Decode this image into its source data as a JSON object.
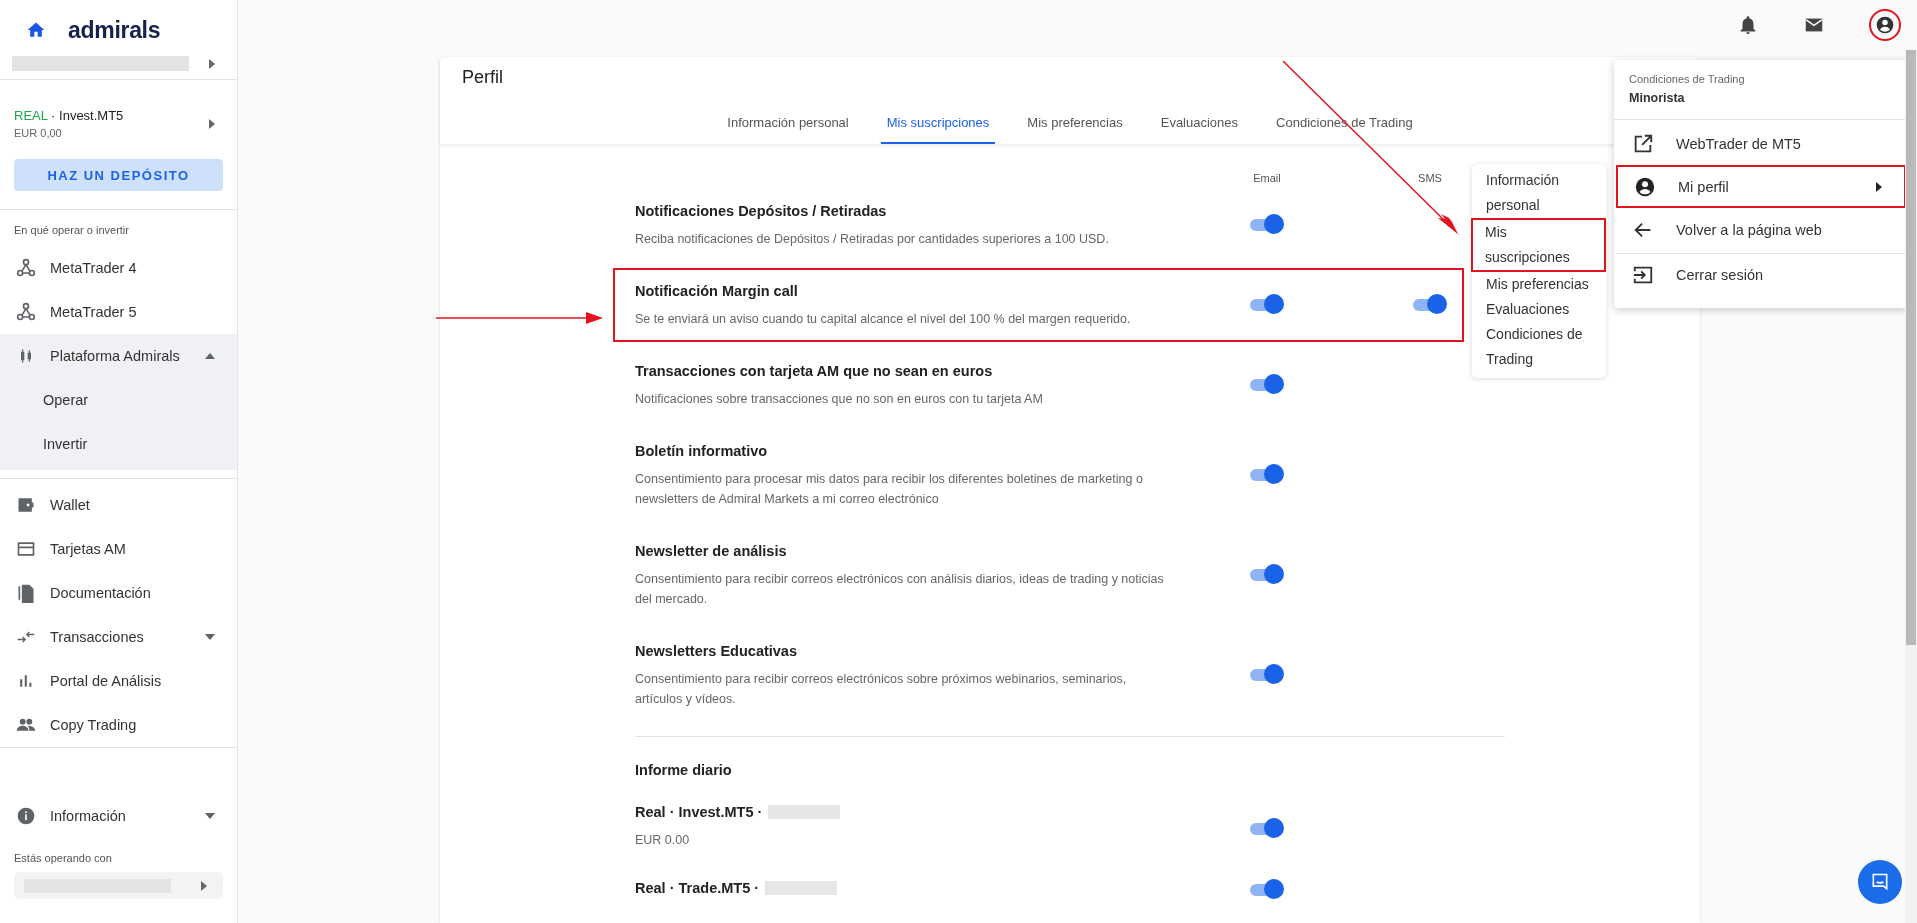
{
  "sidebar": {
    "brand": "admirals",
    "account": {
      "type": "REAL",
      "name": "· Invest.MT5",
      "balance": "EUR 0,00"
    },
    "deposit_button": "HAZ UN DEPÓSITO",
    "sections": [
      {
        "label": "En qué operar o invertir",
        "items": [
          {
            "label": "MetaTrader 4"
          },
          {
            "label": "MetaTrader 5"
          },
          {
            "label": "Plataforma Admirals",
            "expanded": true,
            "children": [
              {
                "label": "Operar"
              },
              {
                "label": "Invertir"
              }
            ]
          }
        ]
      },
      {
        "items": [
          {
            "label": "Wallet"
          },
          {
            "label": "Tarjetas AM"
          },
          {
            "label": "Documentación"
          },
          {
            "label": "Transacciones",
            "expanded": false
          },
          {
            "label": "Portal de Análisis"
          },
          {
            "label": "Copy Trading"
          }
        ]
      },
      {
        "items": [
          {
            "label": "Información",
            "expanded": false
          }
        ]
      }
    ],
    "footer_label": "Estás operando con"
  },
  "topbar": {
    "account_highlighted": true
  },
  "profile": {
    "title": "Perfil",
    "tabs": [
      {
        "label": "Información personal",
        "selected": false
      },
      {
        "label": "Mis suscripciones",
        "selected": true
      },
      {
        "label": "Mis preferencias",
        "selected": false
      },
      {
        "label": "Evaluaciones",
        "selected": false
      },
      {
        "label": "Condiciones de Trading",
        "selected": false
      }
    ],
    "columns": [
      "Email",
      "SMS"
    ],
    "subscriptions": [
      {
        "title": "Notificaciones Depósitos / Retiradas",
        "description": "Reciba notificaciones de Depósitos / Retiradas por cantidades superiores a 100 USD.",
        "email": true,
        "highlighted": false
      },
      {
        "title": "Notificación Margin call",
        "description": "Se te enviará un aviso cuando tu capital alcance el nivel del 100 % del margen requerido.",
        "email": true,
        "sms": true,
        "highlighted": true
      },
      {
        "title": "Transacciones con tarjeta AM que no sean en euros",
        "description": "Notificaciones sobre transacciones que no son en euros con tu tarjeta AM",
        "email": true,
        "highlighted": false
      },
      {
        "title": "Boletín informativo",
        "description": "Consentimiento para procesar mis datos para recibir los diferentes boletines de marketing o newsletters de Admiral Markets a mi correo electrónico",
        "email": true,
        "highlighted": false
      },
      {
        "title": "Newsletter de análisis",
        "description": "Consentimiento para recibir correos electrónicos con análisis diarios, ideas de trading y noticias del mercado.",
        "email": true,
        "highlighted": false
      },
      {
        "title": "Newsletters Educativas",
        "description": "Consentimiento para recibir correos electrónicos sobre próximos webinarios, seminarios, artículos y vídeos.",
        "email": true,
        "highlighted": false
      }
    ],
    "daily_report": {
      "title": "Informe diario",
      "accounts": [
        {
          "label": "Real · Invest.MT5 ·",
          "balance": "EUR 0.00",
          "email": true
        },
        {
          "label": "Real · Trade.MT5 ·",
          "email": true
        }
      ]
    }
  },
  "account_menu": {
    "caption": "Condiciones de Trading",
    "value": "Minorista",
    "items": [
      {
        "label": "WebTrader de MT5",
        "kind": "link",
        "highlighted": false
      },
      {
        "label": "Mi perfil",
        "kind": "submenu",
        "highlighted": true
      },
      {
        "label": "Volver a la página web",
        "kind": "link",
        "highlighted": false
      },
      {
        "label": "Cerrar sesión",
        "kind": "action",
        "highlighted": false
      }
    ]
  },
  "profile_submenu": {
    "items": [
      {
        "label": "Información personal",
        "highlighted": false
      },
      {
        "label": "Mis suscripciones",
        "highlighted": true
      },
      {
        "label": "Mis preferencias",
        "highlighted": false
      },
      {
        "label": "Evaluaciones",
        "highlighted": false
      },
      {
        "label": "Condiciones de Trading",
        "highlighted": false
      }
    ]
  }
}
